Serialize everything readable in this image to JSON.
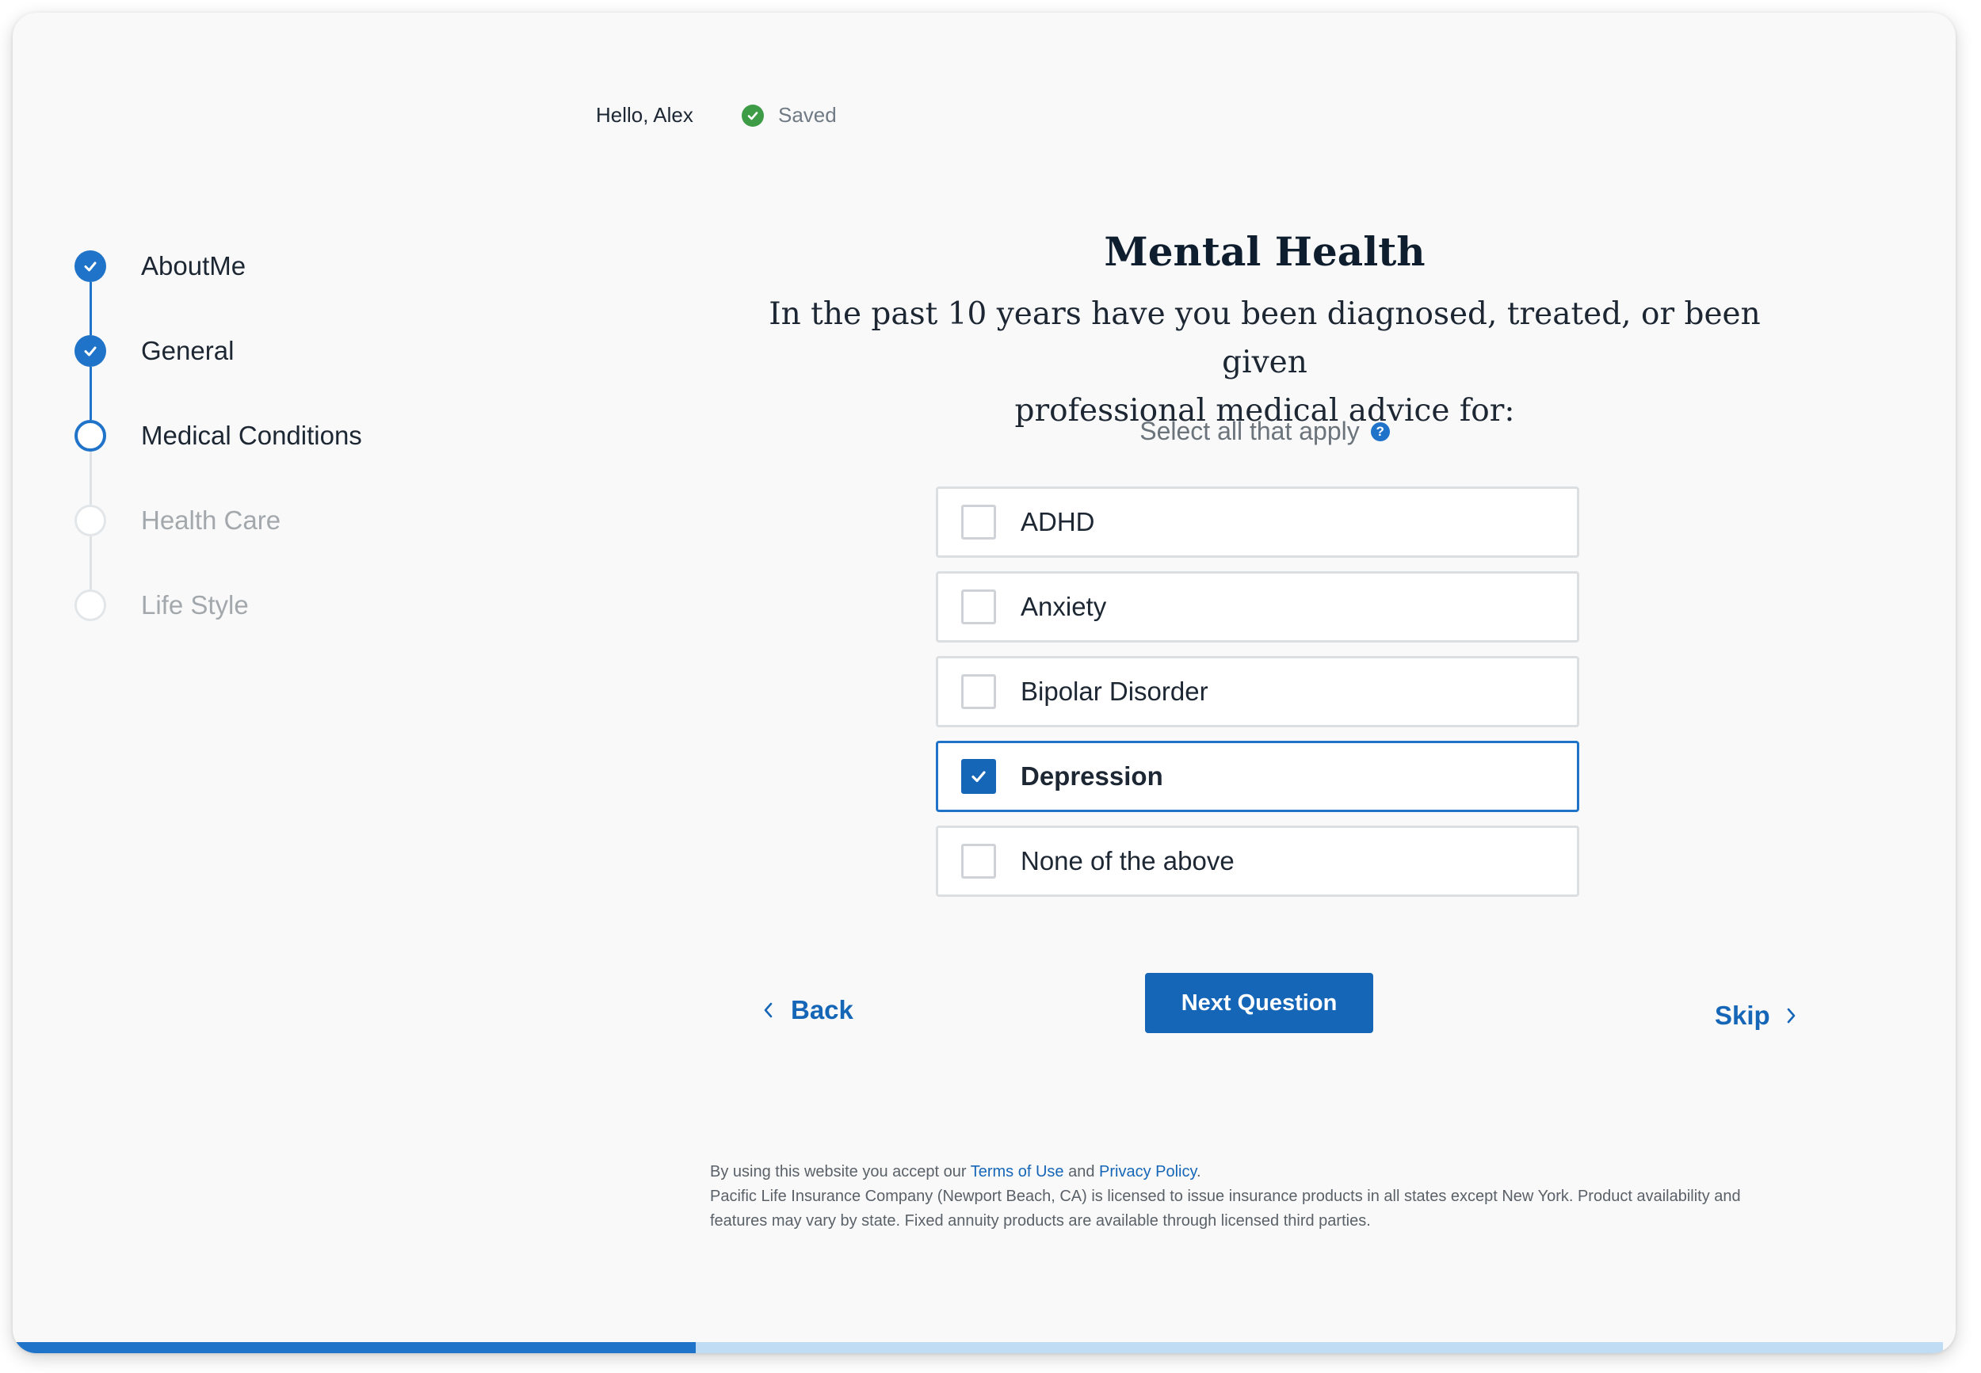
{
  "header": {
    "greeting": "Hello, Alex",
    "saved_label": "Saved",
    "saved_icon": "check-circle-icon"
  },
  "stepper": {
    "steps": [
      {
        "label": "AboutMe",
        "state": "done"
      },
      {
        "label": "General",
        "state": "done"
      },
      {
        "label": "Medical Conditions",
        "state": "current"
      },
      {
        "label": "Health Care",
        "state": "todo"
      },
      {
        "label": "Life Style",
        "state": "todo"
      }
    ]
  },
  "main": {
    "title": "Mental Health",
    "question_line1": "In the past 10 years have you been diagnosed, treated, or been given",
    "question_line2": "professional medical advice for:",
    "hint": "Select all that apply",
    "help_icon": "?",
    "options": [
      {
        "label": "ADHD",
        "checked": false
      },
      {
        "label": "Anxiety",
        "checked": false
      },
      {
        "label": "Bipolar Disorder",
        "checked": false
      },
      {
        "label": "Depression",
        "checked": true
      },
      {
        "label": "None of the above",
        "checked": false
      }
    ]
  },
  "nav": {
    "back_label": "Back",
    "next_label": "Next Question",
    "skip_label": "Skip"
  },
  "footer": {
    "line1_prefix": "By using this website you accept our ",
    "terms_link": "Terms of Use",
    "and": " and ",
    "privacy_link": "Privacy Policy",
    "period": ".",
    "disclaimer": "Pacific Life Insurance Company (Newport Beach, CA) is licensed to issue insurance products in all states except New York. Product availability and features may vary by state. Fixed annuity products are available through licensed third parties."
  },
  "progress": {
    "fraction": 0.354
  },
  "colors": {
    "accent": "#1f73c9",
    "primary_button": "#1666b8",
    "success": "#3e9c47",
    "progress_track": "#bfdcf4"
  }
}
